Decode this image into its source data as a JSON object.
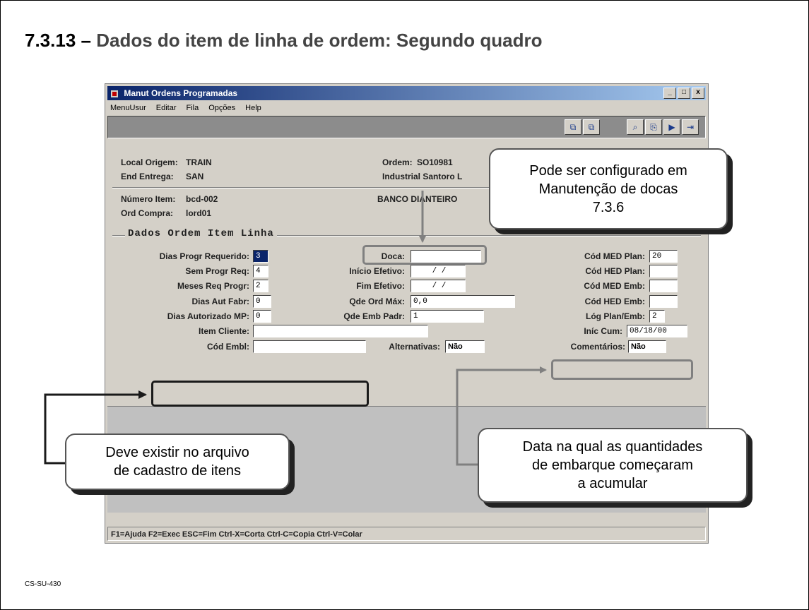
{
  "slide": {
    "title_number": "7.3.13 – ",
    "title_text": "Dados do item de linha de ordem: Segundo quadro",
    "footer_code": "CS-SU-430"
  },
  "window": {
    "title": "Manut Ordens Programadas",
    "controls": {
      "minimize": "_",
      "maximize": "□",
      "close": "x"
    },
    "menu": [
      "MenuUsur",
      "Editar",
      "Fila",
      "Opções",
      "Help"
    ],
    "toolbar_icons": [
      "copy-icon",
      "paste-icon",
      "find-icon",
      "find-next-icon",
      "next-record-icon",
      "exit-icon"
    ]
  },
  "header": {
    "local_origem_label": "Local Origem:",
    "local_origem_value": "TRAIN",
    "end_entrega_label": "End Entrega:",
    "end_entrega_value": "SAN",
    "ordem_label": "Ordem:",
    "ordem_value": "SO10981",
    "cliente_value": "Industrial Santoro L",
    "numero_item_label": "Número Item:",
    "numero_item_value": "bcd-002",
    "item_desc_value": "BANCO DIANTEIRO",
    "ord_compra_label": "Ord Compra:",
    "ord_compra_value": "lord01"
  },
  "section": {
    "title": "Dados Ordem Item Linha"
  },
  "fields": {
    "dias_progr_requerido": {
      "label": "Dias Progr Requerido:",
      "value": "3"
    },
    "sem_progr_req": {
      "label": "Sem Progr Req:",
      "value": "4"
    },
    "meses_req_progr": {
      "label": "Meses Req Progr:",
      "value": "2"
    },
    "dias_aut_fabr": {
      "label": "Dias Aut Fabr:",
      "value": "0"
    },
    "dias_autorizado_mp": {
      "label": "Dias Autorizado MP:",
      "value": "0"
    },
    "item_cliente": {
      "label": "Item Cliente:",
      "value": ""
    },
    "cod_embl": {
      "label": "Cód Embl:",
      "value": ""
    },
    "doca": {
      "label": "Doca:",
      "value": ""
    },
    "inicio_efetivo": {
      "label": "Início Efetivo:",
      "value": "/ /"
    },
    "fim_efetivo": {
      "label": "Fim Efetivo:",
      "value": "/ /"
    },
    "qde_ord_max": {
      "label": "Qde Ord Máx:",
      "value": "0,0"
    },
    "qde_emb_padr": {
      "label": "Qde Emb Padr:",
      "value": "1"
    },
    "alternativas": {
      "label": "Alternativas:",
      "value": "Não"
    },
    "cod_med_plan": {
      "label": "Cód MED Plan:",
      "value": "20"
    },
    "cod_hed_plan": {
      "label": "Cód HED Plan:",
      "value": ""
    },
    "cod_med_emb": {
      "label": "Cód MED Emb:",
      "value": ""
    },
    "cod_hed_emb": {
      "label": "Cód HED Emb:",
      "value": ""
    },
    "log_plan_emb": {
      "label": "Lóg Plan/Emb:",
      "value": "2"
    },
    "inic_cum": {
      "label": "Iníc Cum:",
      "value": "08/18/00"
    },
    "comentarios": {
      "label": "Comentários:",
      "value": "Não"
    }
  },
  "statusbar": {
    "text": "F1=Ajuda F2=Exec ESC=Fim Ctrl-X=Corta Ctrl-C=Copia Ctrl-V=Colar"
  },
  "callouts": {
    "doca_note": "Pode ser configurado em\nManutenção de docas\n7.3.6",
    "cod_embl_note": "Deve existir no arquivo\nde cadastro de itens",
    "inic_cum_note": "Data na qual as quantidades\nde embarque começaram\na acumular"
  }
}
